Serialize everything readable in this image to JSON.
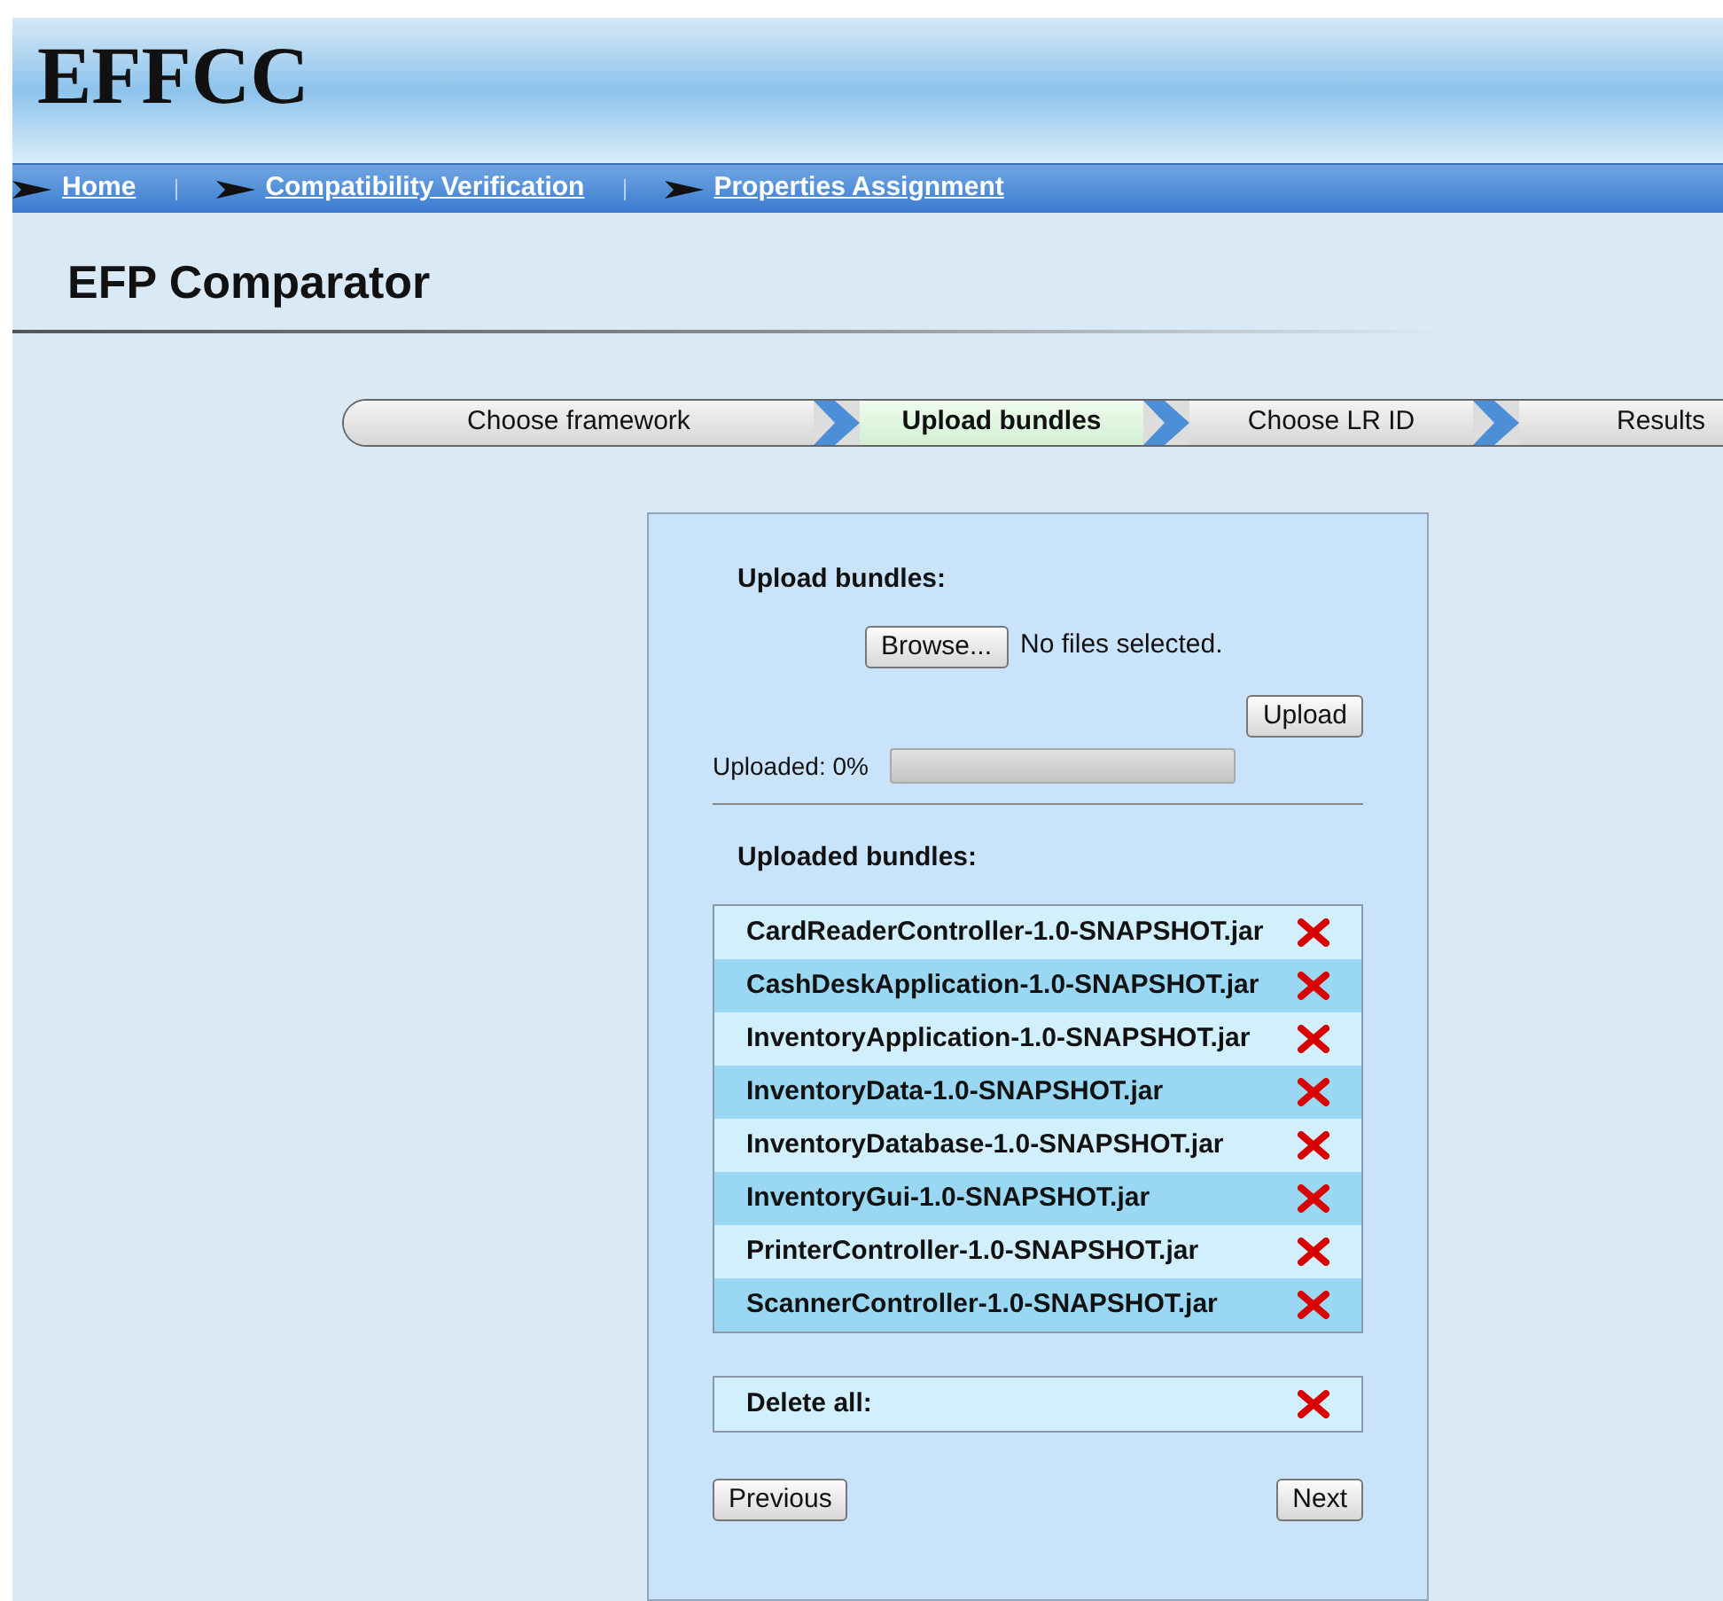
{
  "logo": "EFFCC",
  "nav": [
    {
      "label": "Home"
    },
    {
      "label": "Compatibility Verification"
    },
    {
      "label": "Properties Assignment"
    }
  ],
  "page_title": "EFP Comparator",
  "steps": [
    {
      "label": "Choose framework",
      "selected": false
    },
    {
      "label": "Upload bundles",
      "selected": true
    },
    {
      "label": "Choose LR ID",
      "selected": false
    },
    {
      "label": "Results",
      "selected": false
    }
  ],
  "upload": {
    "heading": "Upload bundles:",
    "browse_button": "Browse...",
    "file_status": "No files selected.",
    "upload_button": "Upload",
    "progress_label": "Uploaded: 0%",
    "level": 0
  },
  "bundles": {
    "heading": "Uploaded bundles:",
    "items": [
      "CardReaderController-1.0-SNAPSHOT.jar",
      "CashDeskApplication-1.0-SNAPSHOT.jar",
      "InventoryApplication-1.0-SNAPSHOT.jar",
      "InventoryData-1.0-SNAPSHOT.jar",
      "InventoryDatabase-1.0-SNAPSHOT.jar",
      "InventoryGui-1.0-SNAPSHOT.jar",
      "PrinterController-1.0-SNAPSHOT.jar",
      "ScannerController-1.0-SNAPSHOT.jar"
    ]
  },
  "delete_all": "Delete all:",
  "buttons": {
    "previous": "Previous",
    "next": "Next"
  }
}
